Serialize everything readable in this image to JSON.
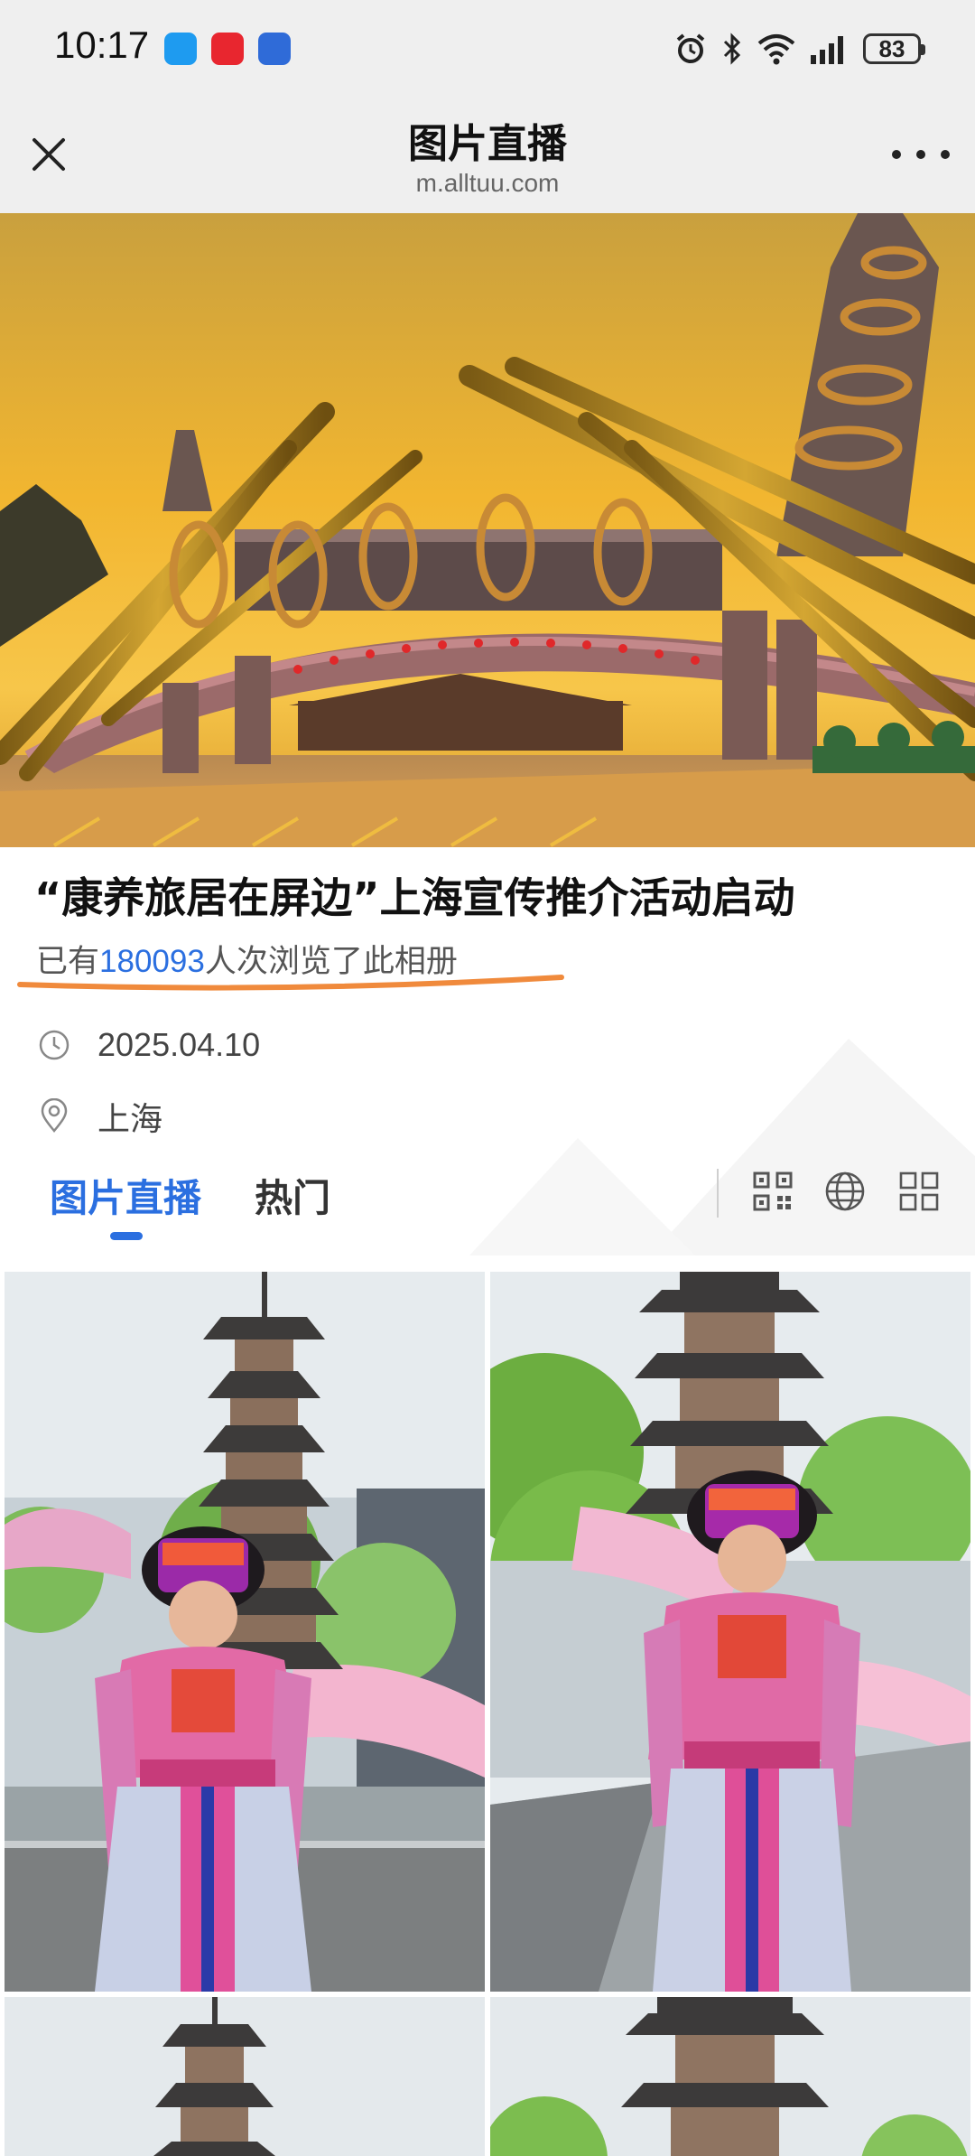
{
  "status_bar": {
    "time": "10:17",
    "app_icons": [
      "message-bubble-icon",
      "huawei-mall-icon",
      "app-store-icon"
    ],
    "system_icons": [
      "alarm-icon",
      "bluetooth-icon",
      "wifi-icon",
      "signal-icon"
    ],
    "battery": "83"
  },
  "titlebar": {
    "title": "图片直播",
    "url": "m.alltuu.com",
    "close_icon": "close-icon",
    "more_icon": "more-dots-icon"
  },
  "album": {
    "title": "“康养旅居在屏边”上海宣传推介活动启动",
    "views_prefix": "已有",
    "views_count": "180093",
    "views_suffix": "人次浏览了此相册",
    "date": "2025.04.10",
    "location": "上海"
  },
  "tabs": [
    {
      "label": "图片直播",
      "active": true
    },
    {
      "label": "热门",
      "active": false
    }
  ],
  "toolbar_icons": [
    "qr-code-icon",
    "globe-icon",
    "grid-layout-icon"
  ],
  "colors": {
    "accent": "#2b6fe0",
    "underline": "#f08a3c"
  }
}
